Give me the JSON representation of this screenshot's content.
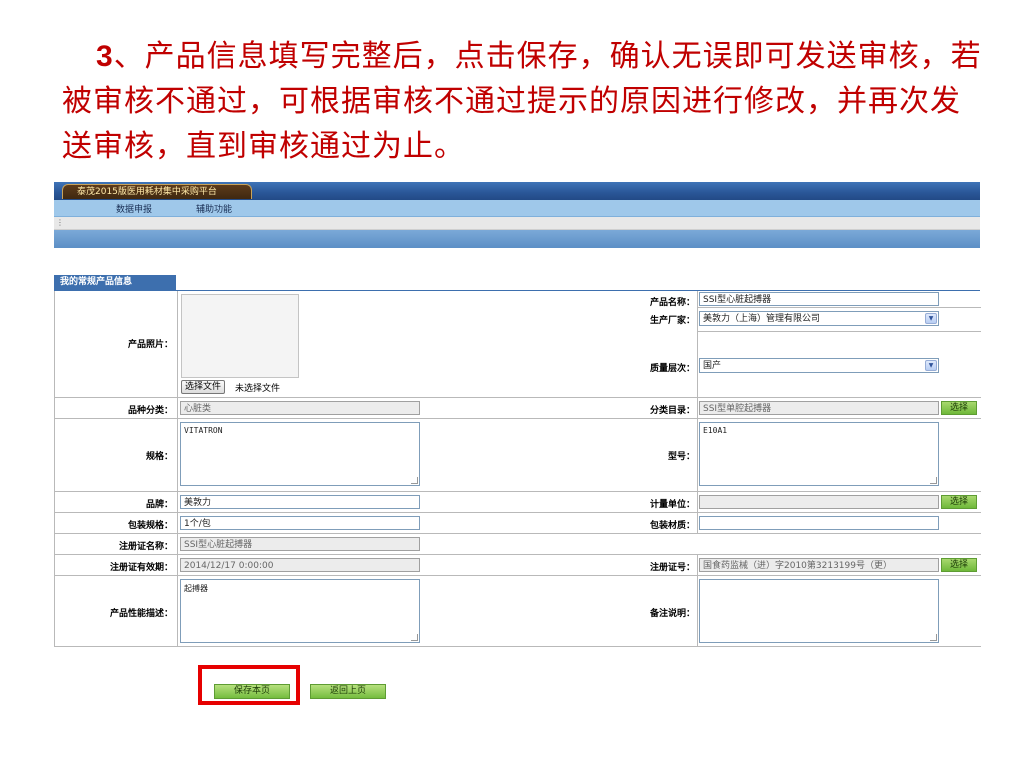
{
  "slide": {
    "title_num": "3",
    "title_text": "、产品信息填写完整后，点击保存，确认无误即可发送审核，若被审核不通过，可根据审核不通过提示的原因进行修改，并再次发送审核，直到审核通过为止。"
  },
  "app": {
    "brand": "泰茂2015版医用耗材集中采购平台",
    "menu": [
      "数据申报",
      "辅助功能"
    ],
    "grip": "⋮",
    "section_title": "我的常规产品信息"
  },
  "form": {
    "photo_label": "产品照片：",
    "file_button": "选择文件",
    "file_status": "未选择文件",
    "product_name_label": "产品名称：",
    "product_name_value": "SSI型心脏起搏器",
    "manufacturer_label": "生产厂家：",
    "manufacturer_value": "美敦力（上海）管理有限公司",
    "quality_label": "质量层次：",
    "quality_value": "国产",
    "category_label": "品种分类：",
    "category_value": "心脏类",
    "catalog_label": "分类目录：",
    "catalog_value": "SSI型单腔起搏器",
    "select_label": "选择",
    "spec_label": "规格：",
    "spec_value": "VITATRON",
    "model_label": "型号：",
    "model_value": "E10A1",
    "brand_label": "品牌：",
    "brand_value": "美敦力",
    "unit_label": "计量单位：",
    "unit_value": "",
    "pack_spec_label": "包装规格：",
    "pack_spec_value": "1个/包",
    "pack_material_label": "包装材质：",
    "pack_material_value": "",
    "reg_name_label": "注册证名称：",
    "reg_name_value": "SSI型心脏起搏器",
    "reg_valid_label": "注册证有效期：",
    "reg_valid_value": "2014/12/17 0:00:00",
    "reg_no_label": "注册证号：",
    "reg_no_value": "国食药监械（进）字2010第3213199号（更）",
    "perf_label": "产品性能描述：",
    "perf_value": "起搏器",
    "remark_label": "备注说明：",
    "remark_value": ""
  },
  "actions": {
    "save": "保存本页",
    "back": "返回上页"
  },
  "colors": {
    "title": "#c00000",
    "topbar": "#2a5697",
    "highlight": "#e60000",
    "button_green": "#75bd3f"
  }
}
